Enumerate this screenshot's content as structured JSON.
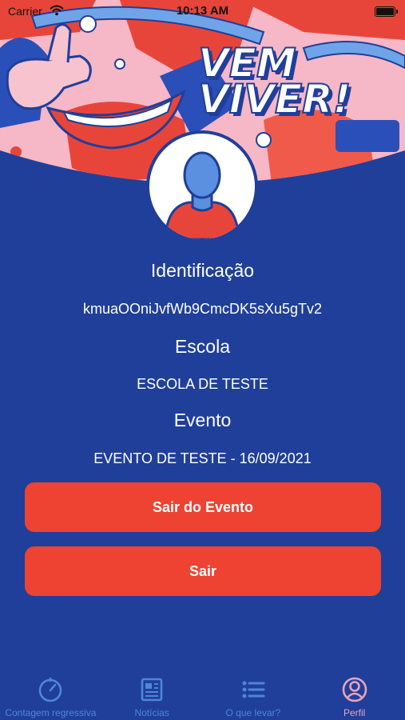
{
  "status_bar": {
    "carrier": "Carrier",
    "time": "10:13 AM"
  },
  "header": {
    "banner_text_line1": "VEM",
    "banner_text_line2": "VIVER!"
  },
  "profile": {
    "identification_label": "Identificação",
    "identification_value": "kmuaOOniJvfWb9CmcDK5sXu5gTv2",
    "school_label": "Escola",
    "school_value": "ESCOLA DE TESTE",
    "event_label": "Evento",
    "event_value": "EVENTO DE TESTE - 16/09/2021"
  },
  "actions": {
    "leave_event": "Sair do Evento",
    "logout": "Sair"
  },
  "tabbar": {
    "items": [
      {
        "label": "Contagem regressiva",
        "icon": "timer-icon"
      },
      {
        "label": "Notícias",
        "icon": "newspaper-icon"
      },
      {
        "label": "O que levar?",
        "icon": "list-icon"
      },
      {
        "label": "Perfil",
        "icon": "user-circle-icon"
      }
    ],
    "active_index": 3
  },
  "colors": {
    "background": "#1f3f9a",
    "button": "#ee4232",
    "tab_inactive": "#4f86d9",
    "tab_active": "#e9a3b8"
  }
}
